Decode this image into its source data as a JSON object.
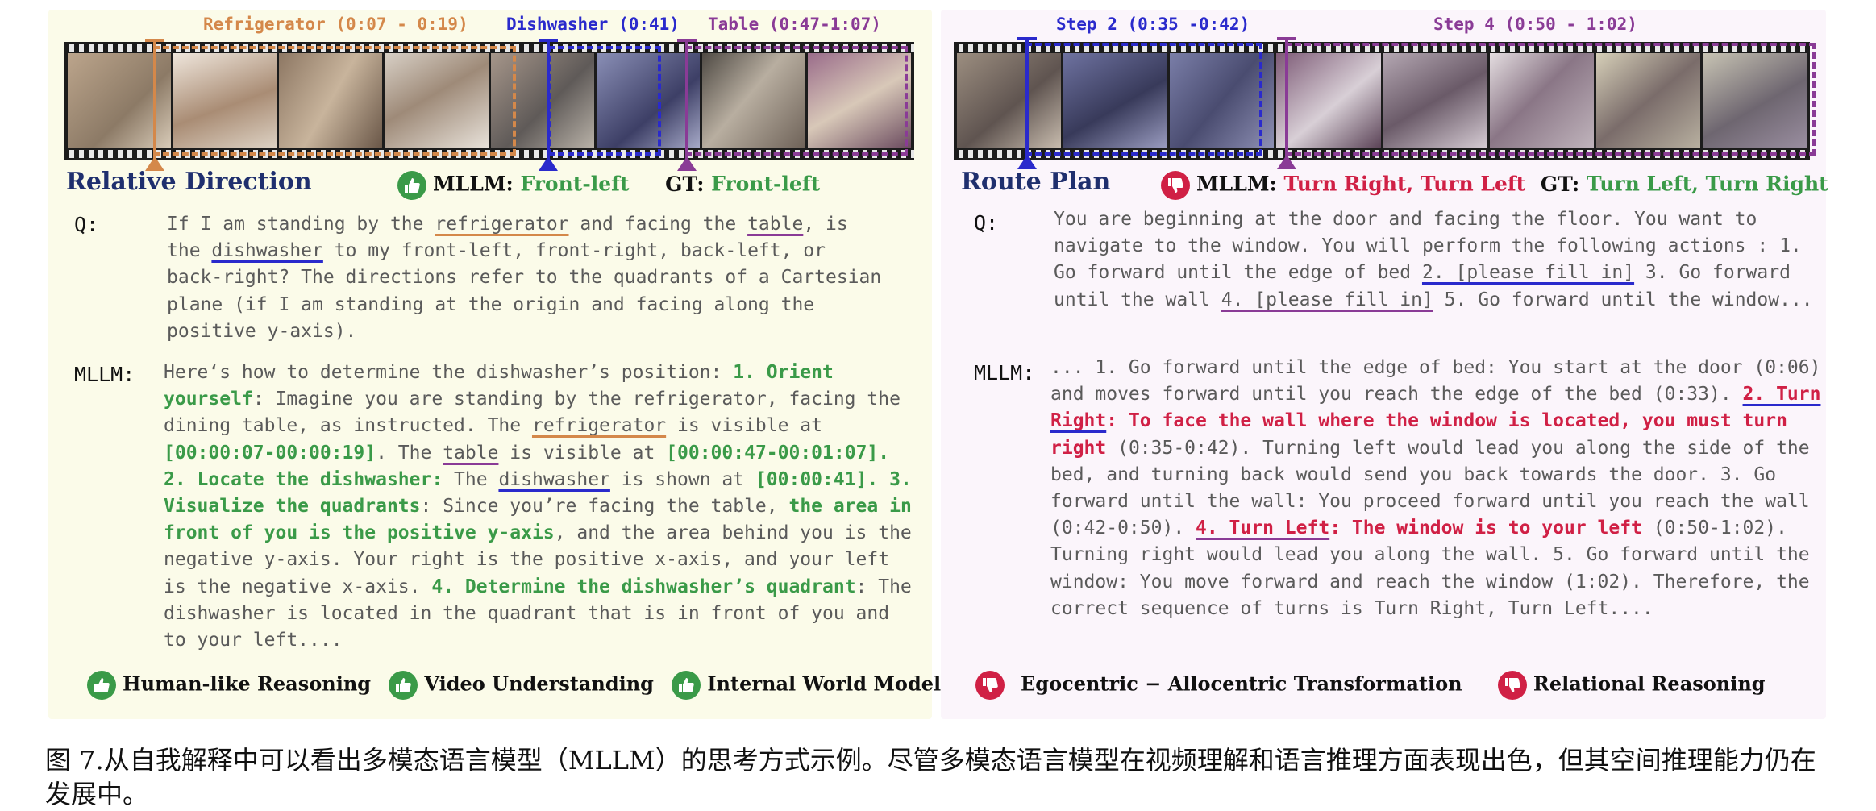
{
  "left": {
    "segments": [
      {
        "label": "Refrigerator (0:07 - 0:19)",
        "color": "#d4884a"
      },
      {
        "label": "Dishwasher (0:41)",
        "color": "#2a2acc"
      },
      {
        "label": "Table (0:47-1:07)",
        "color": "#8a3b96"
      }
    ],
    "heading": "Relative Direction",
    "verdict": {
      "mllm_label": "MLLM:",
      "mllm_answer": "Front-left",
      "gt_label": "GT:",
      "gt_answer": "Front-left",
      "icon": "thumbs-up-icon"
    },
    "q_label": "Q:",
    "question": {
      "p1": "If I am standing by the ",
      "u1": "refrigerator",
      "p2": " and facing the ",
      "u2": "table",
      "p3": ", is the ",
      "u3": "dishwasher",
      "p4": " to my front-left, front-right, back-left, or back-right? The directions refer to the quadrants of a Cartesian plane (if I am standing at the origin and facing along the positive y-axis)."
    },
    "mllm_label": "MLLM:",
    "answer": {
      "a1": "Here‘s how to determine the dishwasher’s position: ",
      "b1": "1. Orient yourself",
      "a2": ": Imagine you are standing by the refrigerator, facing the dining table, as instructed. The ",
      "u1": "refrigerator",
      "a3": " is visible at ",
      "b2": "[00:00:07-00:00:19]",
      "a4": ". The ",
      "u2": "table",
      "a5": " is visible at ",
      "b3": "[00:00:47-00:01:07]. 2. Locate the dishwasher:",
      "a6": " The ",
      "u3": "dishwasher",
      "a7": " is shown at ",
      "b4": "[00:00:41]. 3. Visualize the quadrants",
      "a8": ": Since you’re facing the table, ",
      "b5": "the area in front of you is the positive y-axis",
      "a9": ", and the area behind you is the negative y-axis. Your right is the positive x-axis, and your left is the negative x-axis. ",
      "b6": "4. Determine the dishwasher’s quadrant",
      "a10": ": The dishwasher is located in the quadrant that is in front of you and to your left...."
    },
    "tags": [
      "Human-like Reasoning",
      "Video Understanding",
      "Internal World Model"
    ]
  },
  "right": {
    "segments": [
      {
        "label": "Step 2 (0:35 -0:42)",
        "color": "#2a2acc"
      },
      {
        "label": "Step 4 (0:50 - 1:02)",
        "color": "#8a3b96"
      }
    ],
    "heading": "Route Plan",
    "verdict": {
      "mllm_label": "MLLM:",
      "mllm_answer": "Turn Right, Turn Left",
      "gt_label": "GT:",
      "gt_answer": "Turn Left, Turn Right",
      "icon": "thumbs-down-icon"
    },
    "q_label": "Q:",
    "question": {
      "p1": "You are beginning at the door and facing the floor. You want to navigate to the window. You will perform the following actions : 1. Go forward until the edge of bed ",
      "u1": "2. [please fill in]",
      "p2": " 3. Go forward until the wall ",
      "u2": "4. [please fill in]",
      "p3": " 5. Go forward until the window..."
    },
    "mllm_label": "MLLM:",
    "answer": {
      "a1": "... 1. Go forward until the edge of bed: You start at the door (0:06) and moves forward until you reach the edge of the bed (0:33). ",
      "u1": "2. Turn Right",
      "b1": ": To face the wall where the window is located, you must turn right",
      "a2": " (0:35-0:42). Turning left would lead you along the side of the bed, and turning back would send you back towards the door. 3. Go forward until the wall: You proceed forward until you reach the wall (0:42-0:50). ",
      "u2": "4. Turn Left",
      "b2": ": The window is to your left",
      "a3": " (0:50-1:02). Turning right would lead you along the wall. 5. Go forward until the window: You move forward and reach the window (1:02). Therefore, the correct sequence of turns is Turn Right, Turn Left...."
    },
    "tags": [
      "Egocentric − Allocentric Transformation",
      "Relational Reasoning"
    ]
  },
  "caption": "图 7.从自我解释中可以看出多模态语言模型（MLLM）的思考方式示例。尽管多模态语言模型在视频理解和语言推理方面表现出色，但其空间推理能力仍在发展中。",
  "colors": {
    "green": "#3a9a48",
    "red": "#d02045",
    "orange": "#d4884a",
    "blue": "#2a2acc",
    "purple": "#8a3b96",
    "navy": "#1f2f6e"
  }
}
